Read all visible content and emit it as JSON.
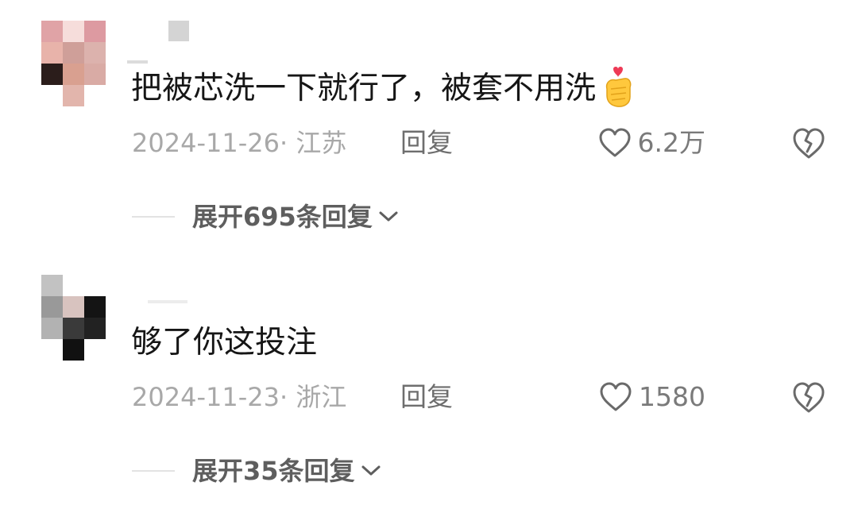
{
  "comments": [
    {
      "text": "把被芯洗一下就行了，被套不用洗",
      "emoji": "finger-heart-emoji",
      "date_location": "2024-11-26· 江苏",
      "reply_label": "回复",
      "like_count": "6.2万",
      "expand_replies_label": "展开695条回复"
    },
    {
      "text": "够了你这投注",
      "date_location": "2024-11-23· 浙江",
      "reply_label": "回复",
      "like_count": "1580",
      "expand_replies_label": "展开35条回复"
    }
  ],
  "icons": {
    "like": "heart-outline-icon",
    "dislike": "broken-heart-icon",
    "expand": "chevron-down-icon"
  },
  "colors": {
    "comment_text": "#161616",
    "meta_text": "#a8a8a8",
    "reply_text": "#6e6e6e",
    "icon_stroke": "#6a6a6a",
    "expand_text": "#5e5e5e"
  }
}
